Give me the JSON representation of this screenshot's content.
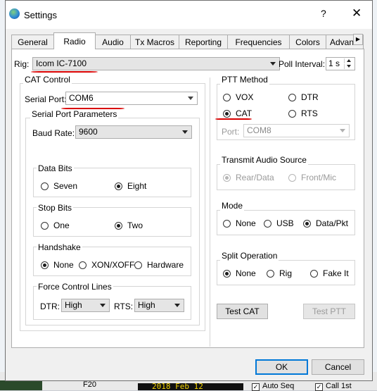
{
  "dialog": {
    "title": "Settings",
    "help": "?",
    "close": "✕"
  },
  "tabs": [
    "General",
    "Radio",
    "Audio",
    "Tx Macros",
    "Reporting",
    "Frequencies",
    "Colors",
    "Advanced"
  ],
  "rig": {
    "label": "Rig:",
    "value": "Icom IC-7100"
  },
  "poll": {
    "label": "Poll Interval:",
    "value": "1 s"
  },
  "cat": {
    "title": "CAT Control",
    "serial_port_label": "Serial Port:",
    "serial_port_value": "COM6",
    "params_title": "Serial Port Parameters",
    "baud_label": "Baud Rate:",
    "baud_value": "9600",
    "data_bits": {
      "title": "Data Bits",
      "options": [
        "Seven",
        "Eight"
      ],
      "selected": "Eight"
    },
    "stop_bits": {
      "title": "Stop Bits",
      "options": [
        "One",
        "Two"
      ],
      "selected": "Two"
    },
    "handshake": {
      "title": "Handshake",
      "options": [
        "None",
        "XON/XOFF",
        "Hardware"
      ],
      "selected": "None"
    },
    "force": {
      "title": "Force Control Lines",
      "dtr_label": "DTR:",
      "dtr_value": "High",
      "rts_label": "RTS:",
      "rts_value": "High"
    }
  },
  "ptt": {
    "title": "PTT Method",
    "options": [
      "VOX",
      "DTR",
      "CAT",
      "RTS"
    ],
    "selected": "CAT",
    "port_label": "Port:",
    "port_value": "COM8"
  },
  "tx_audio": {
    "title": "Transmit Audio Source",
    "options": [
      "Rear/Data",
      "Front/Mic"
    ],
    "selected": "Rear/Data"
  },
  "mode": {
    "title": "Mode",
    "options": [
      "None",
      "USB",
      "Data/Pkt"
    ],
    "selected": "Data/Pkt"
  },
  "split": {
    "title": "Split Operation",
    "options": [
      "None",
      "Rig",
      "Fake It"
    ],
    "selected": "None"
  },
  "buttons": {
    "test_cat": "Test CAT",
    "test_ptt": "Test PTT",
    "ok": "OK",
    "cancel": "Cancel"
  },
  "background": {
    "f20": "F20",
    "time": "2018 Feb 12",
    "auto_seq": "Auto Seq",
    "call_1st": "Call 1st"
  }
}
